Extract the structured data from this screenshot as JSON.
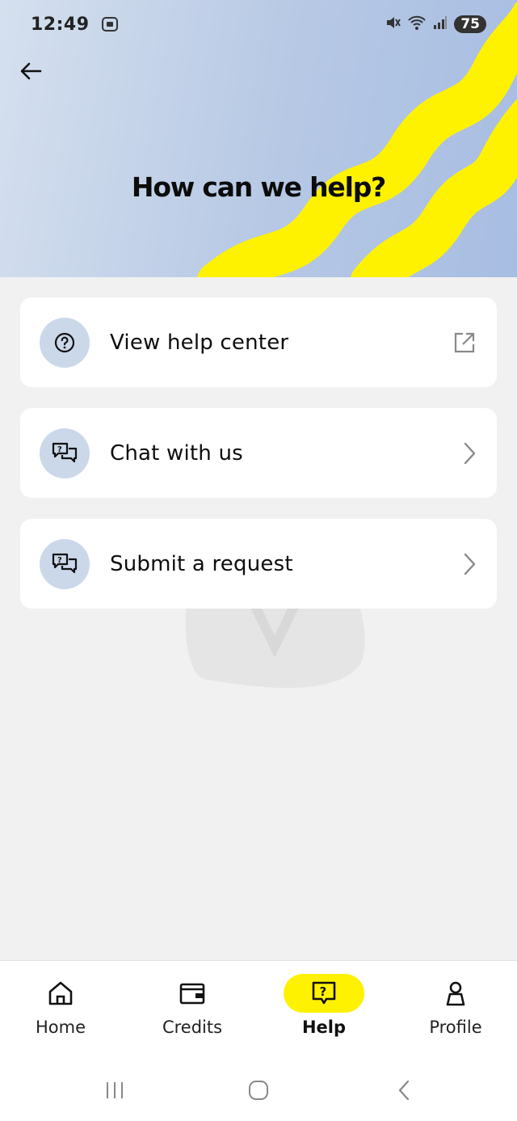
{
  "status_bar": {
    "time": "12:49",
    "battery": "75",
    "icons": [
      "screenshot-icon",
      "mute-icon",
      "wifi-icon",
      "signal-icon"
    ]
  },
  "header": {
    "title": "How can we help?",
    "back_icon": "arrow-left-icon",
    "wave_color": "#fff200"
  },
  "menu": [
    {
      "label": "View help center",
      "icon": "question-circle-icon",
      "trail_icon": "external-link-icon"
    },
    {
      "label": "Chat with us",
      "icon": "chat-bubbles-icon",
      "trail_icon": "chevron-right-icon"
    },
    {
      "label": "Submit a request",
      "icon": "chat-bubbles-icon",
      "trail_icon": "chevron-right-icon"
    }
  ],
  "bottom_nav": {
    "active": "Help",
    "items": [
      {
        "label": "Home",
        "icon": "home-icon"
      },
      {
        "label": "Credits",
        "icon": "wallet-icon"
      },
      {
        "label": "Help",
        "icon": "help-square-icon"
      },
      {
        "label": "Profile",
        "icon": "person-icon"
      }
    ]
  },
  "system_nav": [
    "recents-button",
    "home-button",
    "back-button"
  ],
  "colors": {
    "accent": "#fff200",
    "header_bg": "#b6c8e4",
    "icon_circle": "#cbd8ea",
    "page_bg": "#f1f1f1"
  }
}
